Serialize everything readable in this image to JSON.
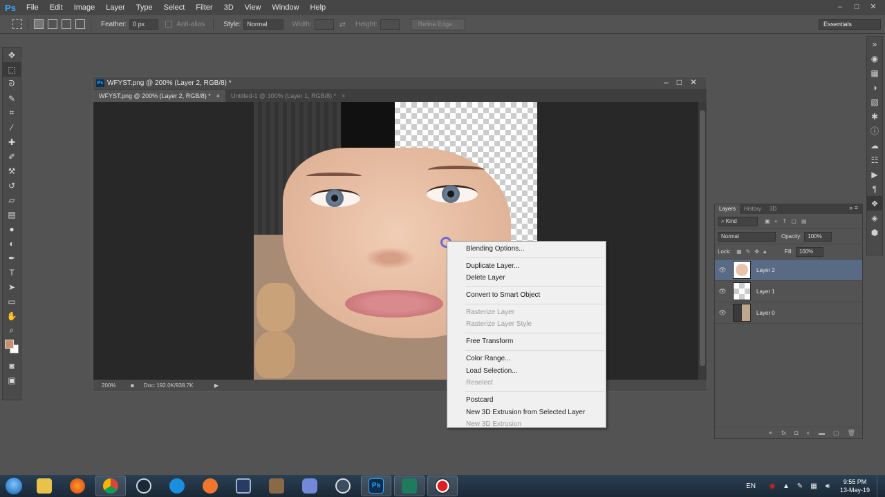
{
  "app": {
    "logo": "Ps",
    "menu": [
      "File",
      "Edit",
      "Image",
      "Layer",
      "Type",
      "Select",
      "Filter",
      "3D",
      "View",
      "Window",
      "Help"
    ],
    "window_controls": [
      "–",
      "□",
      "✕"
    ]
  },
  "options_bar": {
    "feather_label": "Feather:",
    "feather_value": "0 px",
    "antialias_label": "Anti-alias",
    "style_label": "Style:",
    "style_value": "Normal",
    "width_label": "Width:",
    "height_label": "Height:",
    "refine_edge_label": "Refine Edge...",
    "workspace_value": "Essentials"
  },
  "toolbar": {
    "tools": [
      "move-tool",
      "marquee-tool",
      "lasso-tool",
      "quick-select-tool",
      "crop-tool",
      "eyedropper-tool",
      "healing-brush-tool",
      "brush-tool",
      "clone-stamp-tool",
      "history-brush-tool",
      "eraser-tool",
      "gradient-tool",
      "blur-tool",
      "dodge-tool",
      "pen-tool",
      "type-tool",
      "path-select-tool",
      "shape-tool",
      "hand-tool",
      "zoom-tool"
    ],
    "foreground_color": "#c98f72",
    "background_color": "#ffffff"
  },
  "document": {
    "title": "WFYST.png @ 200% (Layer 2, RGB/8) *",
    "tabs": [
      {
        "label": "WFYST.png @ 200% (Layer 2, RGB/8) *",
        "active": true
      },
      {
        "label": "Untitled-1 @ 100% (Layer 1, RGB/8) *",
        "active": false
      }
    ],
    "zoom": "200%",
    "doc_size": "Doc: 192.0K/938.7K"
  },
  "context_menu": {
    "groups": [
      [
        {
          "label": "Blending Options...",
          "enabled": true
        }
      ],
      [
        {
          "label": "Duplicate Layer...",
          "enabled": true
        },
        {
          "label": "Delete Layer",
          "enabled": true
        }
      ],
      [
        {
          "label": "Convert to Smart Object",
          "enabled": true
        }
      ],
      [
        {
          "label": "Rasterize Layer",
          "enabled": false
        },
        {
          "label": "Rasterize Layer Style",
          "enabled": false
        }
      ],
      [
        {
          "label": "Free Transform",
          "enabled": true
        }
      ],
      [
        {
          "label": "Color Range...",
          "enabled": true
        },
        {
          "label": "Load Selection...",
          "enabled": true
        },
        {
          "label": "Reselect",
          "enabled": false
        }
      ],
      [
        {
          "label": "Postcard",
          "enabled": true
        },
        {
          "label": "New 3D Extrusion from Selected Layer",
          "enabled": true
        },
        {
          "label": "New 3D Extrusion",
          "enabled": false
        }
      ]
    ]
  },
  "layers_panel": {
    "tabs": [
      "Layers",
      "History",
      "3D"
    ],
    "filter_label": "Kind",
    "blend_mode": "Normal",
    "opacity_label": "Opacity:",
    "opacity_value": "100%",
    "lock_label": "Lock:",
    "fill_label": "Fill:",
    "fill_value": "100%",
    "layers": [
      {
        "name": "Layer 2",
        "selected": true
      },
      {
        "name": "Layer 1",
        "selected": false
      },
      {
        "name": "Layer 0",
        "selected": false
      }
    ]
  },
  "taskbar": {
    "apps": [
      "windows-explorer",
      "firefox",
      "chrome",
      "steam",
      "app-circle",
      "app-orange",
      "app-monitor",
      "app-game",
      "discord",
      "app-headset",
      "photoshop",
      "app-green",
      "app-record"
    ],
    "language": "EN",
    "time": "9:55 PM",
    "date": "13-May-19"
  }
}
